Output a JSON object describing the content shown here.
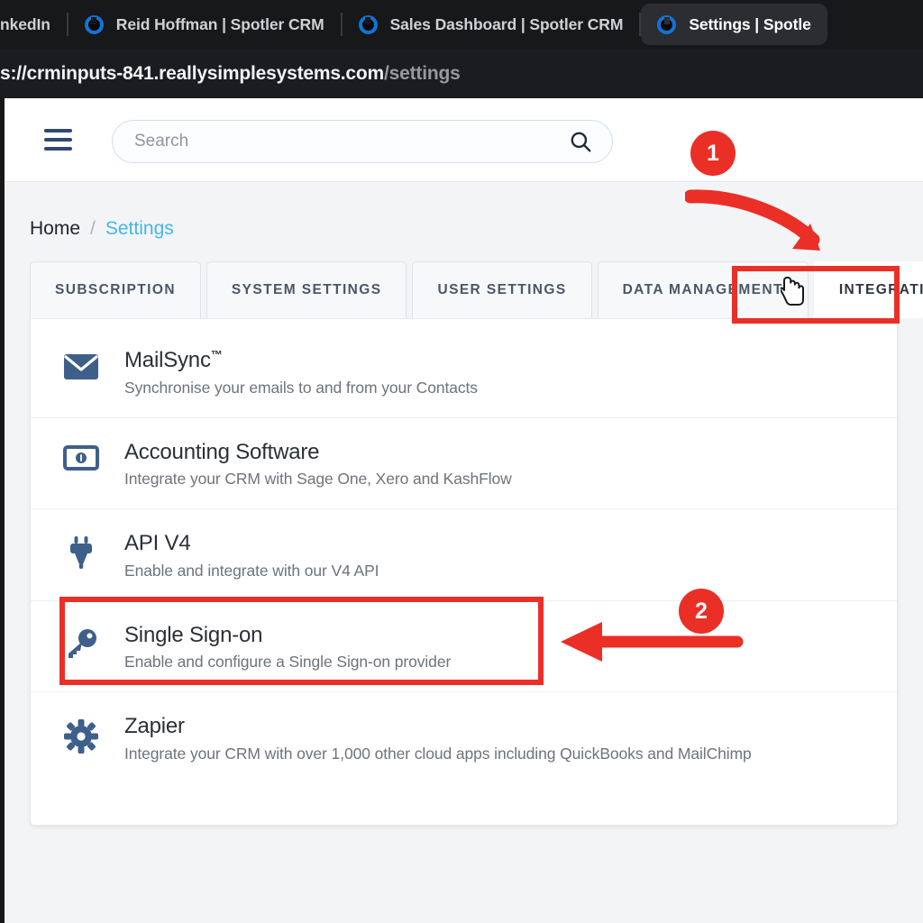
{
  "browser": {
    "tabs": [
      {
        "title": "nkedIn",
        "favicon": "none",
        "active": false
      },
      {
        "title": "Reid Hoffman | Spotler CRM",
        "favicon": "spotler-favicon",
        "active": false
      },
      {
        "title": "Sales Dashboard | Spotler CRM",
        "favicon": "spotler-favicon",
        "active": false
      },
      {
        "title": "Settings | Spotle",
        "favicon": "spotler-favicon",
        "active": true
      }
    ],
    "url": {
      "prefix": "s://",
      "domain": "crminputs-841.reallysimplesystems.com",
      "path": "/settings"
    }
  },
  "appbar": {
    "menu_icon": "hamburger-icon",
    "search": {
      "placeholder": "Search",
      "value": "",
      "icon": "search-icon"
    }
  },
  "breadcrumb": {
    "home": "Home",
    "separator": "/",
    "current": "Settings"
  },
  "tabs": [
    {
      "label": "SUBSCRIPTION",
      "active": false
    },
    {
      "label": "SYSTEM SETTINGS",
      "active": false
    },
    {
      "label": "USER SETTINGS",
      "active": false
    },
    {
      "label": "DATA MANAGEMENT",
      "active": false
    },
    {
      "label": "INTEGRATIONS",
      "active": true
    }
  ],
  "integrations": [
    {
      "icon": "envelope-icon",
      "title": "MailSync",
      "trademark": "™",
      "subtitle": "Synchronise your emails to and from your Contacts"
    },
    {
      "icon": "banknote-icon",
      "title": "Accounting Software",
      "trademark": "",
      "subtitle": "Integrate your CRM with Sage One, Xero and KashFlow"
    },
    {
      "icon": "plug-icon",
      "title": "API V4",
      "trademark": "",
      "subtitle": "Enable and integrate with our V4 API"
    },
    {
      "icon": "key-icon",
      "title": "Single Sign-on",
      "trademark": "",
      "subtitle": "Enable and configure a Single Sign-on provider"
    },
    {
      "icon": "gear-icon",
      "title": "Zapier",
      "trademark": "",
      "subtitle": "Integrate your CRM with over 1,000 other cloud apps including QuickBooks and MailChimp"
    }
  ],
  "annotations": {
    "accent_color": "#ea2f27",
    "step_one": "1",
    "step_two": "2"
  },
  "colors": {
    "accent_red": "#ea2f27",
    "link_blue": "#45b6e8",
    "icon_blue": "#3f5f8b",
    "page_bg": "#f3f4f6",
    "card_bg": "#ffffff"
  }
}
